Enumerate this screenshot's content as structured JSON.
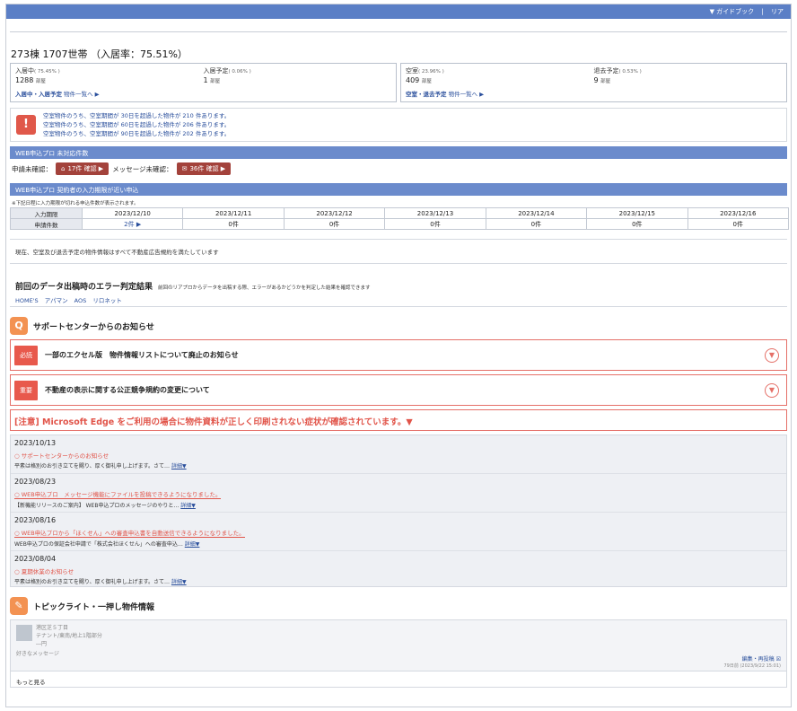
{
  "header": {
    "links": [
      "▼ ガイドブック",
      "|",
      "リア"
    ]
  },
  "summary": {
    "title": "273棟 1707世帯 （入居率：75.51%）",
    "boxes": [
      {
        "cols": [
          {
            "label": "入居中",
            "pct": "( 75.45% )",
            "value": "1288",
            "unit": "部屋"
          },
          {
            "label": "入居予定",
            "pct": "( 0.06% )",
            "value": "1",
            "unit": "部屋"
          }
        ],
        "link_bold": "入居中・入居予定",
        "link": "物件一覧へ ▶"
      },
      {
        "cols": [
          {
            "label": "空室",
            "pct": "( 23.96% )",
            "value": "409",
            "unit": "部屋"
          },
          {
            "label": "退去予定",
            "pct": "( 0.53% )",
            "value": "9",
            "unit": "部屋"
          }
        ],
        "link_bold": "空室・退去予定",
        "link": "物件一覧へ ▶"
      }
    ]
  },
  "vacancy_alert": {
    "icon": "!",
    "lines": [
      "空室物件のうち、空室期間が 30日を超過した物件が 210 件あります。",
      "空室物件のうち、空室期間が 60日を超過した物件が 206 件あります。",
      "空室物件のうち、空室期間が 90日を超過した物件が 202 件あります。"
    ]
  },
  "web_unconfirmed": {
    "bar": "WEB申込プロ 未対応件数",
    "apply_label": "申請未確認：",
    "apply_btn": "17件 確認 ▶",
    "msg_label": "メッセージ未確認：",
    "msg_btn": "36件 確認 ▶"
  },
  "deadline": {
    "bar": "WEB申込プロ 契約者の入力期限が近い申込",
    "note": "※下記日程に入力期限が切れる申込件数が表示されます。",
    "row1_label": "入力期限",
    "row2_label": "申請件数",
    "dates": [
      "2023/12/10",
      "2023/12/11",
      "2023/12/12",
      "2023/12/13",
      "2023/12/14",
      "2023/12/15",
      "2023/12/16"
    ],
    "counts": [
      "2件 ▶",
      "0件",
      "0件",
      "0件",
      "0件",
      "0件",
      "0件"
    ]
  },
  "ad_note": "現在、空室及び退去予定の物件情報はすべて不動産広告規約を満たしています",
  "error_check": {
    "title": "前回のデータ出稿時のエラー判定結果",
    "desc": "前回のリアプロからデータを出稿する際、エラーがあるかどうかを判定した結果を確認できます",
    "portals": [
      "HOME'S",
      "アパマン",
      "AOS",
      "リロネット"
    ]
  },
  "support": {
    "title": "サポートセンターからのお知らせ",
    "notices": [
      {
        "badge": "必読",
        "text": "一部のエクセル版　物件情報リストについて廃止のお知らせ"
      },
      {
        "badge": "重要",
        "text": "不動産の表示に関する公正競争規約の変更について"
      }
    ],
    "edge_warning": "[注意] Microsoft Edge をご利用の場合に物件資料が正しく印刷されない症状が確認されています。▼",
    "news": [
      {
        "date": "2023/10/13",
        "headline": "○ サポートセンターからのお知らせ",
        "summary": "平素は格別のお引き立てを賜り、厚く御礼申し上げます。さて…",
        "more": "詳細▼"
      },
      {
        "date": "2023/08/23",
        "headline": "○ WEB申込プロ　メッセージ機能にファイルを投稿できるようになりました。",
        "summary": "【新機能リリースのご案内】 WEB申込プロのメッセージのやりと…",
        "more": "詳細▼"
      },
      {
        "date": "2023/08/16",
        "headline": "○ WEB申込プロから「ほくせん」への審査申込書を自動送信できるようになりました。",
        "summary": "WEB申込プロの保証会社申請で「株式会社ほくせん」への審査申込…",
        "more": "詳細▼"
      },
      {
        "date": "2023/08/04",
        "headline": "○ 夏期休業のお知らせ",
        "summary": "平素は格別のお引き立てを賜り、厚く御礼申し上げます。さて…",
        "more": "詳細▼"
      }
    ]
  },
  "topics": {
    "title": "トピックライト・一押し物件情報",
    "item": {
      "lines": [
        "港区芝５丁目",
        "テナント/東南/地上1階部分",
        "―円"
      ],
      "message": "好きなメッセージ",
      "edit": "編集・再投稿",
      "meta": "79日前 (2023/9/22 15:01)"
    },
    "more": "もっと見る"
  }
}
